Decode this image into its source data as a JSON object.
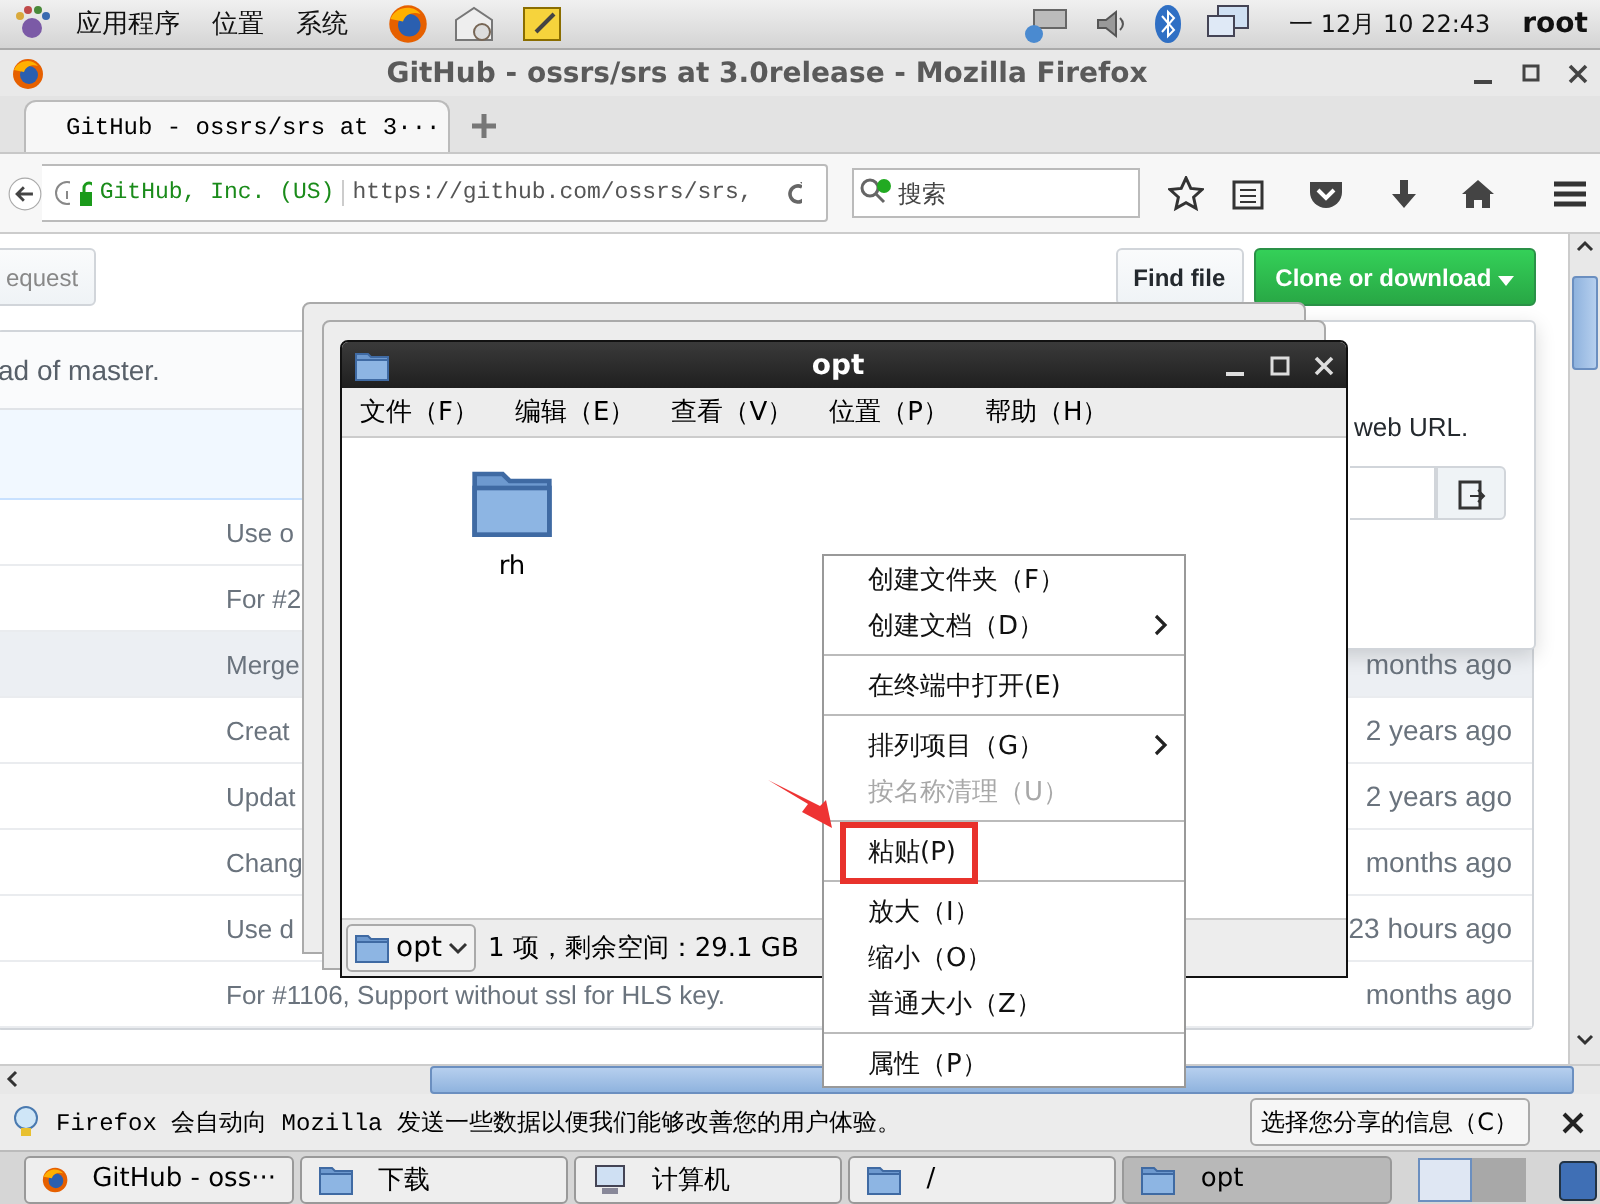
{
  "top_panel": {
    "menus": [
      "应用程序",
      "位置",
      "系统"
    ],
    "clock": "一 12月 10 22:43",
    "user": "root"
  },
  "browser": {
    "title": "GitHub - ossrs/srs at 3.0release - Mozilla Firefox",
    "tabs": [
      {
        "label": "GitHub - ossrs/srs at 3···",
        "selected": true
      }
    ],
    "identity": "GitHub, Inc. (US)",
    "url": "https://github.com/ossrs/srs,",
    "search": {
      "placeholder": "搜索"
    }
  },
  "page": {
    "pull_request_button": "equest",
    "find_file_button": "Find file",
    "clone_button": "Clone or download",
    "branch_note": "ad of master.",
    "clone_popup": {
      "text": "web URL."
    },
    "rows": [
      {
        "message": "Use o",
        "highlighted": false
      },
      {
        "message": "For #2",
        "highlighted": false
      },
      {
        "message": "Merge",
        "age": "months ago",
        "highlighted": true
      },
      {
        "message": "Creat",
        "age": "2 years ago",
        "highlighted": false
      },
      {
        "message": "Updat",
        "age": "2 years ago",
        "highlighted": false
      },
      {
        "message": "Chang",
        "age": "months ago",
        "highlighted": false
      },
      {
        "message": "Use d",
        "age": "23 hours ago",
        "highlighted": false
      },
      {
        "message": "For #1106, Support without ssl for HLS key.",
        "age": "months ago",
        "highlighted": false
      }
    ]
  },
  "notification": {
    "text": "Firefox 会自动向 Mozilla 发送一些数据以便我们能够改善您的用户体验。",
    "button": "选择您分享的信息（C）"
  },
  "file_manager": {
    "title": "opt",
    "menus": [
      "文件（F）",
      "编辑（E）",
      "查看（V）",
      "位置（P）",
      "帮助（H）"
    ],
    "files": [
      {
        "name": "rh"
      }
    ],
    "location": "opt",
    "status": "1 项，剩余空间：29.1 GB"
  },
  "context_menu": [
    {
      "kind": "item",
      "label": "创建文件夹（F）",
      "submenu": false,
      "disabled": false,
      "annotated": false
    },
    {
      "kind": "item",
      "label": "创建文档（D）",
      "submenu": true,
      "disabled": false,
      "annotated": false
    },
    {
      "kind": "separator"
    },
    {
      "kind": "item",
      "label": "在终端中打开(E)",
      "submenu": false,
      "disabled": false,
      "annotated": false
    },
    {
      "kind": "separator"
    },
    {
      "kind": "item",
      "label": "排列项目（G）",
      "submenu": true,
      "disabled": false,
      "annotated": false
    },
    {
      "kind": "item",
      "label": "按名称清理（U）",
      "submenu": false,
      "disabled": true,
      "annotated": false
    },
    {
      "kind": "separator"
    },
    {
      "kind": "item",
      "label": "粘贴(P)",
      "submenu": false,
      "disabled": false,
      "annotated": true
    },
    {
      "kind": "separator"
    },
    {
      "kind": "item",
      "label": "放大（I）",
      "submenu": false,
      "disabled": false,
      "annotated": false
    },
    {
      "kind": "item",
      "label": "缩小（O）",
      "submenu": false,
      "disabled": false,
      "annotated": false
    },
    {
      "kind": "item",
      "label": "普通大小（Z）",
      "submenu": false,
      "disabled": false,
      "annotated": false
    },
    {
      "kind": "separator"
    },
    {
      "kind": "item",
      "label": "属性（P）",
      "submenu": false,
      "disabled": false,
      "annotated": false
    }
  ],
  "taskbar": [
    {
      "kind": "browser",
      "label": "GitHub - oss···",
      "selected": false
    },
    {
      "kind": "folder-download",
      "label": "下载",
      "selected": false
    },
    {
      "kind": "computer",
      "label": "计算机",
      "selected": false
    },
    {
      "kind": "folder",
      "label": "/",
      "selected": false
    },
    {
      "kind": "folder",
      "label": "opt",
      "selected": true
    }
  ]
}
